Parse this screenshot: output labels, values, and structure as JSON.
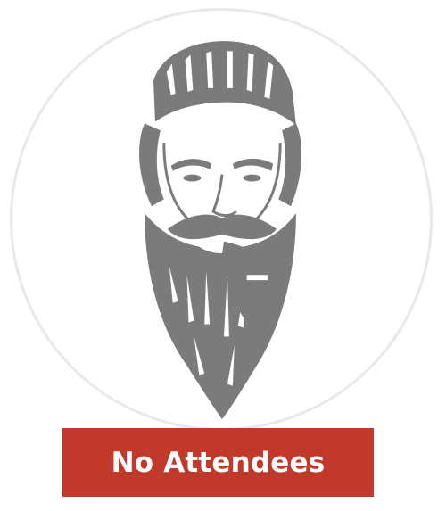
{
  "avatar": {
    "icon": "bearded-man-illustration-icon",
    "ring_color": "#e9e9e9",
    "ink_color": "#7b7b7b"
  },
  "status": {
    "label": "No Attendees",
    "background_color": "#c0392b",
    "text_color": "#ffffff"
  }
}
